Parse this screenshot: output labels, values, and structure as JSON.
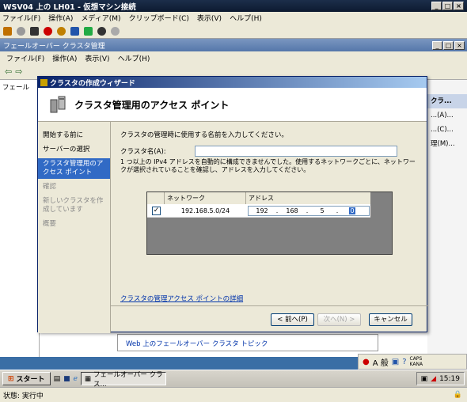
{
  "vm": {
    "title": "WSV04 上の LH01 - 仮想マシン接続",
    "menu": [
      "ファイル(F)",
      "操作(A)",
      "メディア(M)",
      "クリップボード(C)",
      "表示(V)",
      "ヘルプ(H)"
    ]
  },
  "app": {
    "title": "フェールオーバー クラスタ管理",
    "menu": [
      "ファイル(F)",
      "操作(A)",
      "表示(V)",
      "ヘルプ(H)"
    ],
    "tree_root": "フェール",
    "actions_header": "クラ...",
    "actions": [
      "...(A)...",
      "...(C)...",
      "理(M)..."
    ],
    "bottom_link": "Web 上のフェールオーバー クラスタ トピック"
  },
  "wizard": {
    "title": "クラスタの作成ウィザード",
    "heading": "クラスタ管理用のアクセス ポイント",
    "nav": [
      {
        "label": "開始する前に",
        "state": "normal"
      },
      {
        "label": "サーバーの選択",
        "state": "normal"
      },
      {
        "label": "クラスタ管理用のアクセス ポイント",
        "state": "active"
      },
      {
        "label": "確認",
        "state": "disabled"
      },
      {
        "label": "新しいクラスタを作成しています",
        "state": "disabled"
      },
      {
        "label": "概要",
        "state": "disabled"
      }
    ],
    "instruction": "クラスタの管理時に使用する名前を入力してください。",
    "cluster_name_label": "クラスタ名(A):",
    "cluster_name_value": "",
    "warning": "1 つ以上の IPv4 アドレスを自動的に構成できませんでした。使用するネットワークごとに、ネットワークが選択されていることを確認し、アドレスを入力してください。",
    "table": {
      "headers": [
        "ネットワーク",
        "アドレス"
      ],
      "rows": [
        {
          "checked": true,
          "network": "192.168.5.0/24",
          "address": [
            "192",
            "168",
            "5",
            "0"
          ]
        }
      ]
    },
    "details_link": "クラスタの管理アクセス ポイントの詳細",
    "buttons": {
      "back": "< 前へ(P)",
      "next": "次へ(N) >",
      "cancel": "キャンセル"
    }
  },
  "taskbar": {
    "start": "スタート",
    "task": "フェールオーバー クラス...",
    "time": "15:19",
    "ime_mode": "A 般",
    "caps": "CAPS KANA"
  },
  "status": "状態: 実行中"
}
